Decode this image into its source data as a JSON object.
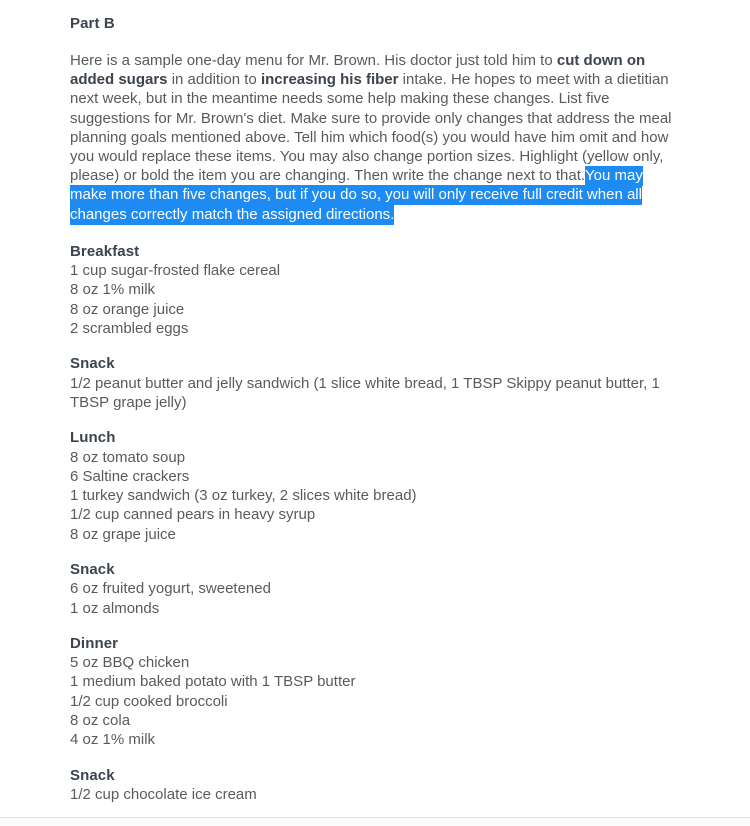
{
  "document": {
    "part_title": "Part B",
    "intro": {
      "seg1": "Here is a sample one-day menu for Mr. Brown. His doctor just told him to ",
      "bold1": "cut down on added sugars",
      "seg2": " in addition to ",
      "bold2": "increasing his fiber",
      "seg3": " intake. He hopes to meet with a dietitian next week, but in the meantime needs some help making these changes. List five suggestions for Mr. Brown's diet. Make sure to provide only changes that address the meal planning goals mentioned above. Tell him which food(s) you would have him omit and how you would replace these items. You may also change portion sizes. Highlight (yellow only, please) or bold the item you are changing. Then write the change next to that.",
      "selected": "You may make more than five changes, but if you do so, you will only receive full credit when all changes correctly match the assigned directions."
    },
    "meals": [
      {
        "name": "Breakfast",
        "items": [
          "1 cup sugar-frosted flake cereal",
          "8 oz 1% milk",
          "8 oz orange juice",
          "2 scrambled eggs"
        ]
      },
      {
        "name": "Snack",
        "items": [
          "1/2 peanut butter and jelly sandwich (1 slice white bread, 1 TBSP Skippy peanut butter, 1 TBSP grape jelly)"
        ]
      },
      {
        "name": "Lunch",
        "items": [
          "8 oz tomato soup",
          "6 Saltine crackers",
          "1 turkey sandwich (3 oz turkey, 2 slices white bread)",
          "1/2 cup canned pears in heavy syrup",
          "8 oz grape juice"
        ]
      },
      {
        "name": "Snack",
        "items": [
          "6 oz fruited yogurt, sweetened",
          "1 oz almonds"
        ]
      },
      {
        "name": "Dinner",
        "items": [
          "5 oz BBQ chicken",
          "1 medium baked potato with 1 TBSP butter",
          "1/2 cup cooked broccoli",
          "8 oz cola",
          "4 oz 1% milk"
        ]
      },
      {
        "name": "Snack",
        "items": [
          "1/2 cup chocolate ice cream"
        ]
      }
    ]
  },
  "colors": {
    "selection_background": "#1d8bf1",
    "selection_text": "#ffffff",
    "heading_text": "#3c4450",
    "body_text": "#575b60",
    "page_background": "#ffffff"
  }
}
